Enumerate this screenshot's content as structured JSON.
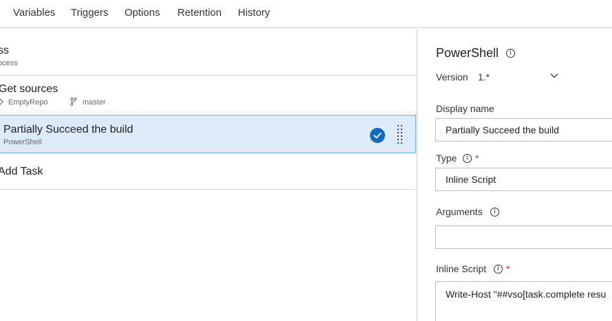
{
  "tabs": [
    "Variables",
    "Triggers",
    "Options",
    "Retention",
    "History"
  ],
  "pipeline": {
    "title": "ss",
    "subtitle": "ocess"
  },
  "get_sources": {
    "title": "Get sources",
    "repo": "EmptyRepo",
    "branch": "master"
  },
  "task": {
    "title": "Partially Succeed the build",
    "subtitle": "PowerShell"
  },
  "add_task_label": "Add Task",
  "details": {
    "title": "PowerShell",
    "version_label": "Version",
    "version_value": "1.*",
    "display_name_label": "Display name",
    "display_name_value": "Partially Succeed the build",
    "type_label": "Type",
    "type_value": "Inline Script",
    "arguments_label": "Arguments",
    "arguments_value": "",
    "inline_script_label": "Inline Script",
    "inline_script_value": "Write-Host \"##vso[task.complete resu",
    "required_mark": "*"
  },
  "icons": {
    "info": "info-icon",
    "check": "check-circle-icon",
    "grip": "drag-handle-icon",
    "repo": "repo-icon",
    "branch": "branch-icon",
    "chevron": "chevron-down-icon"
  },
  "colors": {
    "selected_bg": "#dcebf7",
    "accent": "#0f6cbd",
    "required": "#c4314b"
  }
}
